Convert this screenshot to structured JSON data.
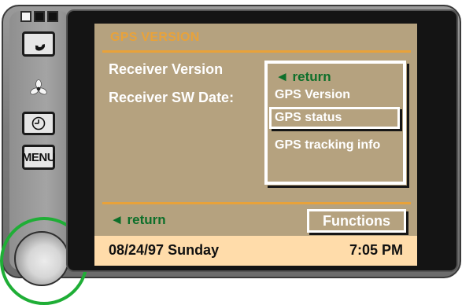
{
  "screen": {
    "title": "GPS VERSION",
    "labels": [
      "Receiver Version",
      "Receiver SW Date:"
    ],
    "menu": {
      "return_label": "◄ return",
      "items": [
        "GPS Version",
        "GPS status",
        "GPS tracking info"
      ],
      "selected_index": 1
    },
    "bottom": {
      "return_label": "◄  return",
      "functions_label": "Functions"
    },
    "status": {
      "date": "08/24/97 Sunday",
      "time": "7:05 PM"
    }
  },
  "hardware": {
    "menu_button_label": "MENU",
    "icons": [
      "phone-icon",
      "fan-icon",
      "clock-icon"
    ]
  },
  "colors": {
    "screen_bg": "#b5a27f",
    "accent_orange": "#e8a23a",
    "return_green": "#0d6f2a",
    "status_bar": "#ffdcaa",
    "knob_ring": "#1fae36"
  }
}
